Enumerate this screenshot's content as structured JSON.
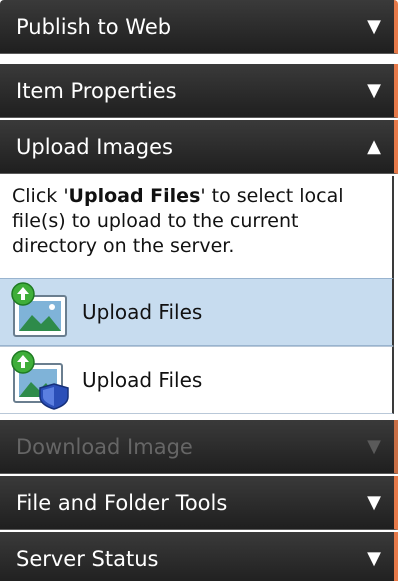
{
  "sections": {
    "publish_to_web": {
      "label": "Publish to Web",
      "arrow": "▼"
    },
    "item_properties": {
      "label": "Item Properties",
      "arrow": "▼"
    },
    "upload_images": {
      "label": "Upload Images",
      "arrow": "▲"
    },
    "download_image": {
      "label": "Download Image",
      "arrow": "▼"
    },
    "file_and_folder_tools": {
      "label": "File and Folder Tools",
      "arrow": "▼"
    },
    "server_status": {
      "label": "Server Status",
      "arrow": "▼"
    }
  },
  "upload": {
    "desc_prefix": "Click '",
    "desc_bold": "Upload Files",
    "desc_suffix": "' to select local file(s) to upload to the current directory on the server.",
    "items": [
      {
        "label": "Upload Files",
        "icon": "upload-image-icon",
        "selected": true
      },
      {
        "label": "Upload Files",
        "icon": "upload-image-shield-icon",
        "selected": false
      }
    ]
  },
  "colors": {
    "header_bg": "#2a2a2a",
    "accent": "#e77a4a",
    "selected_bg": "#c7dcef"
  }
}
